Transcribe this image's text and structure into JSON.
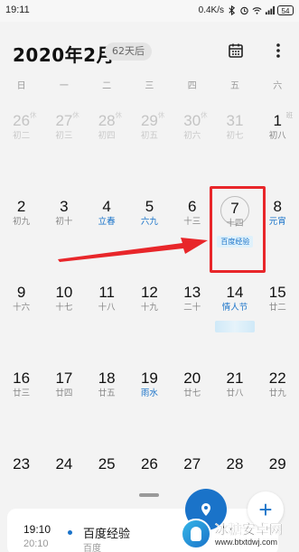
{
  "status_bar": {
    "time": "19:11",
    "network_speed": "0.4K/s",
    "battery": "54",
    "icons": [
      "bluetooth-icon",
      "alarm-icon",
      "wifi-icon",
      "signal-icon",
      "battery-icon"
    ]
  },
  "header": {
    "title": "2020年2月",
    "days_badge": "62天后",
    "icons": [
      "calendar-icon",
      "more-vertical-icon"
    ]
  },
  "weekdays": [
    "日",
    "一",
    "二",
    "三",
    "四",
    "五",
    "六"
  ],
  "weeks": [
    [
      {
        "day": "26",
        "sub": "初二",
        "badge": "休",
        "muted": true
      },
      {
        "day": "27",
        "sub": "初三",
        "badge": "休",
        "muted": true
      },
      {
        "day": "28",
        "sub": "初四",
        "badge": "休",
        "muted": true
      },
      {
        "day": "29",
        "sub": "初五",
        "badge": "休",
        "muted": true
      },
      {
        "day": "30",
        "sub": "初六",
        "badge": "休",
        "muted": true
      },
      {
        "day": "31",
        "sub": "初七",
        "badge": "",
        "muted": true
      },
      {
        "day": "1",
        "sub": "初八",
        "badge": "班",
        "muted": false
      }
    ],
    [
      {
        "day": "2",
        "sub": "初九"
      },
      {
        "day": "3",
        "sub": "初十"
      },
      {
        "day": "4",
        "sub": "立春",
        "sub_style": "solar"
      },
      {
        "day": "5",
        "sub": "六九",
        "sub_style": "solar"
      },
      {
        "day": "6",
        "sub": "十三"
      },
      {
        "day": "7",
        "sub": "十四",
        "today": true,
        "event": "百度经验"
      },
      {
        "day": "8",
        "sub": "元宵",
        "sub_style": "holiday"
      }
    ],
    [
      {
        "day": "9",
        "sub": "十六"
      },
      {
        "day": "10",
        "sub": "十七"
      },
      {
        "day": "11",
        "sub": "十八"
      },
      {
        "day": "12",
        "sub": "十九"
      },
      {
        "day": "13",
        "sub": "二十"
      },
      {
        "day": "14",
        "sub": "情人节",
        "sub_style": "holiday",
        "blurred_event": true
      },
      {
        "day": "15",
        "sub": "廿二"
      }
    ],
    [
      {
        "day": "16",
        "sub": "廿三"
      },
      {
        "day": "17",
        "sub": "廿四"
      },
      {
        "day": "18",
        "sub": "廿五"
      },
      {
        "day": "19",
        "sub": "雨水",
        "sub_style": "solar"
      },
      {
        "day": "20",
        "sub": "廿七"
      },
      {
        "day": "21",
        "sub": "廿八"
      },
      {
        "day": "22",
        "sub": "廿九"
      }
    ],
    [
      {
        "day": "23",
        "sub": ""
      },
      {
        "day": "24",
        "sub": ""
      },
      {
        "day": "25",
        "sub": ""
      },
      {
        "day": "26",
        "sub": ""
      },
      {
        "day": "27",
        "sub": ""
      },
      {
        "day": "28",
        "sub": ""
      },
      {
        "day": "29",
        "sub": ""
      }
    ]
  ],
  "event_card": {
    "start_time": "19:10",
    "end_time": "20:10",
    "title": "百度经验",
    "subtitle": "百度"
  },
  "fab_today_icon": "calendar-today-icon",
  "fab_add_label": "+",
  "watermark": {
    "title": "冰糖安卓网",
    "url": "www.btxtdwj.com"
  },
  "colors": {
    "accent": "#1a73c9",
    "highlight": "#e8262a",
    "background": "#f3f3f3"
  }
}
